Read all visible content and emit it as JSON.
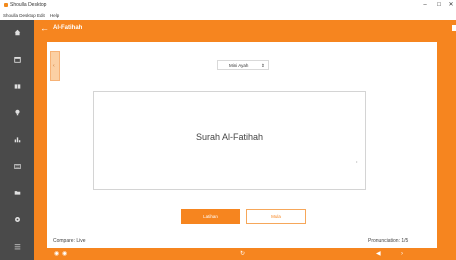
{
  "window": {
    "title": "Shoulla Desktop",
    "min": "–",
    "max": "☐",
    "close": "✕"
  },
  "menu": [
    "Shoulla Desktop",
    "Edit",
    "Help"
  ],
  "sidebar": {
    "icons": [
      "home-icon",
      "calendar-icon",
      "book-icon",
      "bulb-icon",
      "chart-icon",
      "keyboard-icon",
      "folder-icon",
      "settings-icon",
      "menu-icon"
    ]
  },
  "header": {
    "back": "←",
    "title": "Al-Fatihah"
  },
  "side_tab": "‹",
  "selector": {
    "value": "Mini Ayah",
    "caret": "⇕"
  },
  "surah": {
    "title": "Surah Al-Fatihah",
    "dot": "•"
  },
  "buttons": {
    "primary": "Latihan",
    "secondary": "Mula"
  },
  "status": {
    "left": "Compare: Live",
    "right": "Pronunciation: 1/5"
  },
  "bottom": {
    "icon_a": "◉",
    "icon_b": "◉",
    "refresh": "↻",
    "prev": "◀",
    "next": "›"
  },
  "colors": {
    "accent": "#f6851f",
    "sidebar": "#4a4a4a"
  }
}
